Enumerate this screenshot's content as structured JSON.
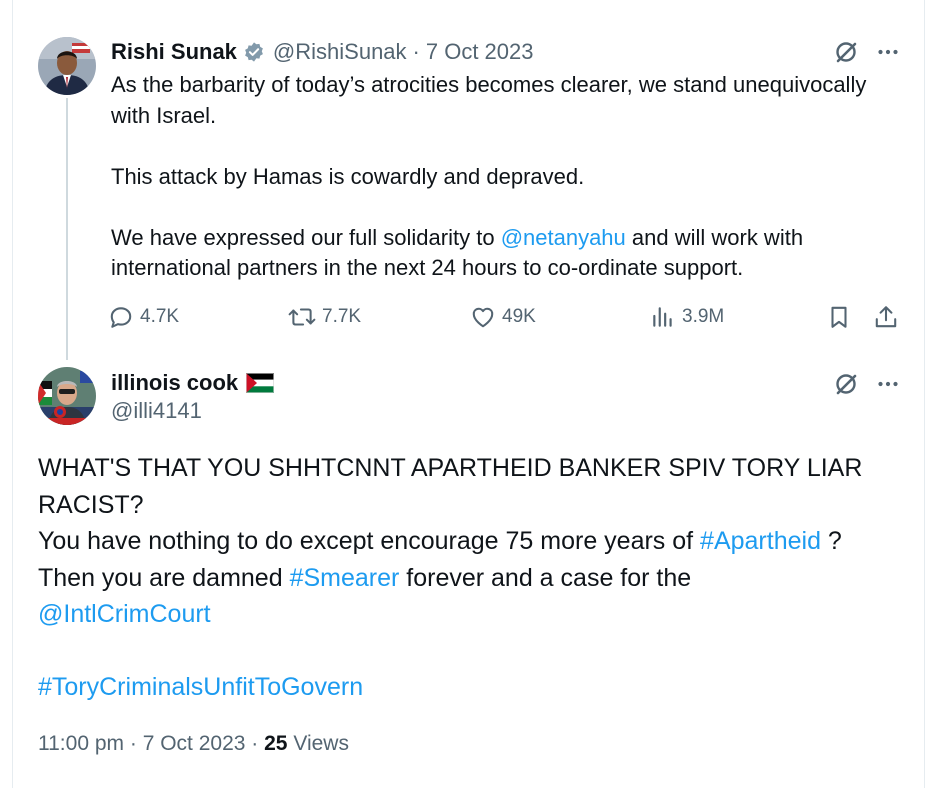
{
  "tweet1": {
    "name": "Rishi Sunak",
    "handle": "@RishiSunak",
    "separator": "·",
    "date": "7 Oct 2023",
    "icons": [
      "grok-icon",
      "more-icon",
      "verified-badge-icon"
    ],
    "body": {
      "line1": "As the barbarity of today’s atrocities becomes clearer, we stand unequivocally with Israel.",
      "line2": "This attack by Hamas is cowardly and depraved.",
      "line3_before": "We have expressed our full solidarity to ",
      "line3_mention": "@netanyahu",
      "line3_after": " and will work with international partners in the next 24 hours to co-ordinate support."
    },
    "actions": {
      "replies": "4.7K",
      "reposts": "7.7K",
      "likes": "49K",
      "views": "3.9M"
    }
  },
  "tweet2": {
    "name": "illinois cook",
    "handle": "@illi4141",
    "flag": "palestine-flag",
    "body": {
      "p1": "WHAT'S THAT YOU SHHTCNNT APARTHEID BANKER SPIV TORY LIAR RACIST?",
      "p2_before": "You have nothing to do except encourage 75 more years of ",
      "p2_hashtag": "#Apartheid",
      "p2_after": " ?",
      "p3_before": "Then you are damned ",
      "p3_hashtag": "#Smearer",
      "p3_after": " forever and a case for the",
      "p4_mention": "@IntlCrimCourt",
      "p5_hashtag": "#ToryCriminalsUnfitToGovern"
    },
    "meta": {
      "time": "11:00 pm",
      "separator": "·",
      "date": "7 Oct 2023",
      "separator2": "·",
      "views_count": "25",
      "views_label": "Views"
    }
  },
  "colors": {
    "text": "#0f1419",
    "secondary": "#536471",
    "link": "#1d9bf0",
    "verified": "#829aab",
    "thread_line": "#cfd9de"
  }
}
